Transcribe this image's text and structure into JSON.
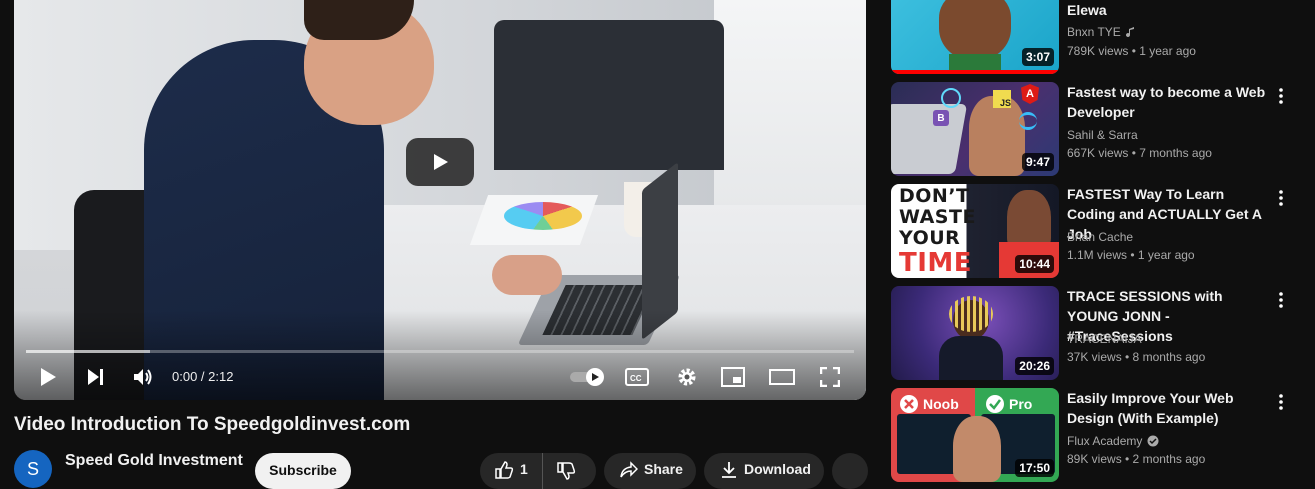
{
  "player": {
    "time_display": "0:00 / 2:12",
    "progress_buffered_fraction": 0.15,
    "controls": [
      "play-icon",
      "next-icon",
      "volume-icon",
      "autoplay-toggle",
      "captions-icon",
      "settings-icon",
      "miniplayer-icon",
      "theater-icon",
      "fullscreen-icon"
    ]
  },
  "video": {
    "title": "Video Introduction To Speedgoldinvest.com",
    "channel_name": "Speed Gold Investment",
    "channel_avatar_letter": "S",
    "subscribe_label": "Subscribe",
    "like_count": "1",
    "share_label": "Share",
    "download_label": "Download"
  },
  "recommendations": [
    {
      "title": "Elewa",
      "channel": "Bnxn TYE",
      "channel_badge": "music-note-icon",
      "meta": "789K views • 1 year ago",
      "duration": "3:07",
      "progress_fraction": 1.0
    },
    {
      "title": "Fastest way to become a Web Developer",
      "channel": "Sahil & Sarra",
      "meta": "667K views • 7 months ago",
      "duration": "9:47"
    },
    {
      "title": "FASTEST Way To Learn Coding and ACTUALLY Get A Job",
      "channel": "Brian Cache",
      "meta": "1.1M views • 1 year ago",
      "duration": "10:44",
      "thumb_text": [
        "DON’T",
        "WASTE",
        "YOUR",
        "TIME"
      ]
    },
    {
      "title": "TRACE SESSIONS with YOUNG JONN - #TraceSessions",
      "channel": "TRACENAIJA",
      "meta": "37K views • 8 months ago",
      "duration": "20:26"
    },
    {
      "title": "Easily Improve Your Web Design (With Example)",
      "channel": "Flux Academy",
      "channel_badge": "verified-icon",
      "meta": "89K views • 2 months ago",
      "duration": "17:50",
      "thumb_text": [
        "Noob",
        "Pro"
      ]
    }
  ],
  "thumb_badges": {
    "js": "JS",
    "angular": "A",
    "bootstrap": "B"
  },
  "colors": {
    "background": "#0f0f0f",
    "progress_red": "#ff0000",
    "avatar_blue": "#1565c0"
  }
}
